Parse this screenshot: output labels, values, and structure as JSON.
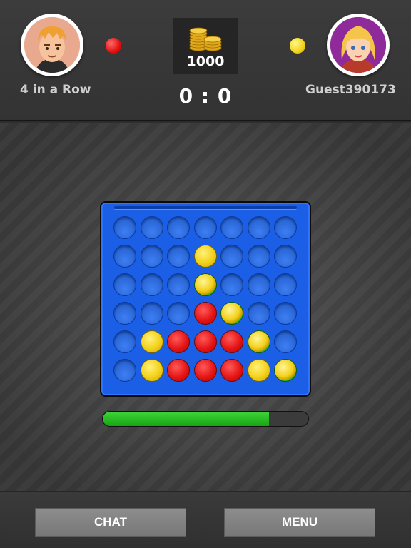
{
  "player1": {
    "name": "4 in a Row",
    "color": "#e01010",
    "avatar_icon": "boy-avatar-icon"
  },
  "player2": {
    "name": "Guest390173",
    "color": "#f3d21a",
    "avatar_icon": "girl-avatar-icon"
  },
  "coins": {
    "amount": "1000",
    "icon": "gold-coins-icon"
  },
  "score": "0 : 0",
  "board": {
    "columns": 7,
    "rows": 6,
    "cells": [
      [
        "empty",
        "empty",
        "empty",
        "empty",
        "empty",
        "empty",
        "empty"
      ],
      [
        "empty",
        "empty",
        "empty",
        "yellow",
        "empty",
        "empty",
        "empty"
      ],
      [
        "empty",
        "empty",
        "empty",
        "win-yellow",
        "empty",
        "empty",
        "empty"
      ],
      [
        "empty",
        "empty",
        "empty",
        "red",
        "win-yellow",
        "empty",
        "empty"
      ],
      [
        "empty",
        "yellow",
        "red",
        "red",
        "red",
        "win-yellow",
        "empty"
      ],
      [
        "empty",
        "yellow",
        "red",
        "red",
        "red",
        "yellow",
        "win-yellow"
      ]
    ]
  },
  "turn_timer": {
    "fraction": 0.81
  },
  "buttons": {
    "chat_label": "CHAT",
    "menu_label": "MENU"
  }
}
